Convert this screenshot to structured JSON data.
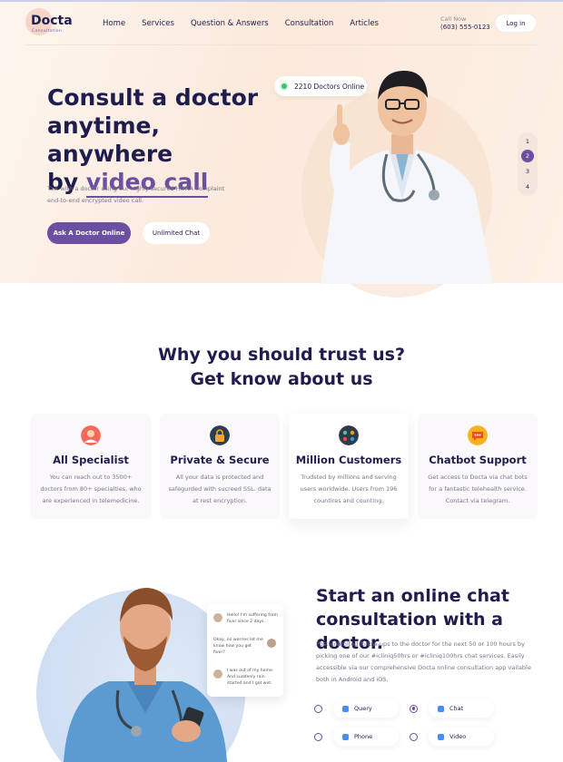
{
  "brand": {
    "logo_text": "Docta",
    "logo_sub": "Consultation"
  },
  "nav": {
    "items": [
      "Home",
      "Services",
      "Question & Answers",
      "Consultation",
      "Articles"
    ]
  },
  "header": {
    "call_label": "Call Now",
    "call_number": "(603) 555-0123",
    "login_label": "Log in"
  },
  "hero": {
    "title_line1": "Consult a doctor",
    "title_line2": "anytime, anywhere",
    "title_line3_prefix": "by ",
    "title_highlight": "video call",
    "description": "Talk with a doctor using our highly secured HIPAA complaint end-to-end encrypted video call.",
    "primary_button": "Ask A Doctor Online",
    "secondary_button": "Unlimited Chat",
    "online_badge": "2210 Doctors Online",
    "pager": [
      "1",
      "2",
      "3",
      "4"
    ],
    "pager_active": 2
  },
  "trust": {
    "title_line1": "Why you should trust us?",
    "title_line2": "Get know about us",
    "cards": [
      {
        "title": "All Specialist",
        "desc": "You can reach out to 3500+ doctors from 80+ specialties, who are experienced in telemedicine.",
        "icon": "doctor-icon",
        "color": "#e8504a"
      },
      {
        "title": "Private & Secure",
        "desc": "All your data is protected and safegurded with sucreed SSL. data at rest encryption.",
        "icon": "lock-icon",
        "color": "#2c3e50"
      },
      {
        "title": "Million Customers",
        "desc": "Trudsted by millions and serving users worldwide. Users from 196 countires and counting.",
        "icon": "users-icon",
        "color": "#2f3b48"
      },
      {
        "title": "Chatbot Support",
        "desc": "Get access to Docta via chat bots for a fantastic telehealth service. Contact via telegram.",
        "icon": "chat-icon",
        "color": "#f5a623"
      }
    ]
  },
  "chat_preview": {
    "messages": [
      "Hello! I'm suffering from fiver since 2 days.",
      "Okay, no worries let me know how you get fiver?",
      "I was out of my home. And suddenly rain started and I got wet."
    ]
  },
  "consult": {
    "title_line1": "Start an online chat",
    "title_line2": "consultation with a doctor.",
    "description": "Post unlimited follow-ups to the doctor for the next 50 or 100 hours by picking one of our #icliniq50hrs or #icliniq100hrs chat services. Easily accessible via our comprehensive Docta online consultation app vailable both in Android and iOS.",
    "options": [
      {
        "label": "Query",
        "selected": false
      },
      {
        "label": "Chat",
        "selected": true
      },
      {
        "label": "Phone",
        "selected": false
      },
      {
        "label": "Video",
        "selected": false
      }
    ]
  }
}
